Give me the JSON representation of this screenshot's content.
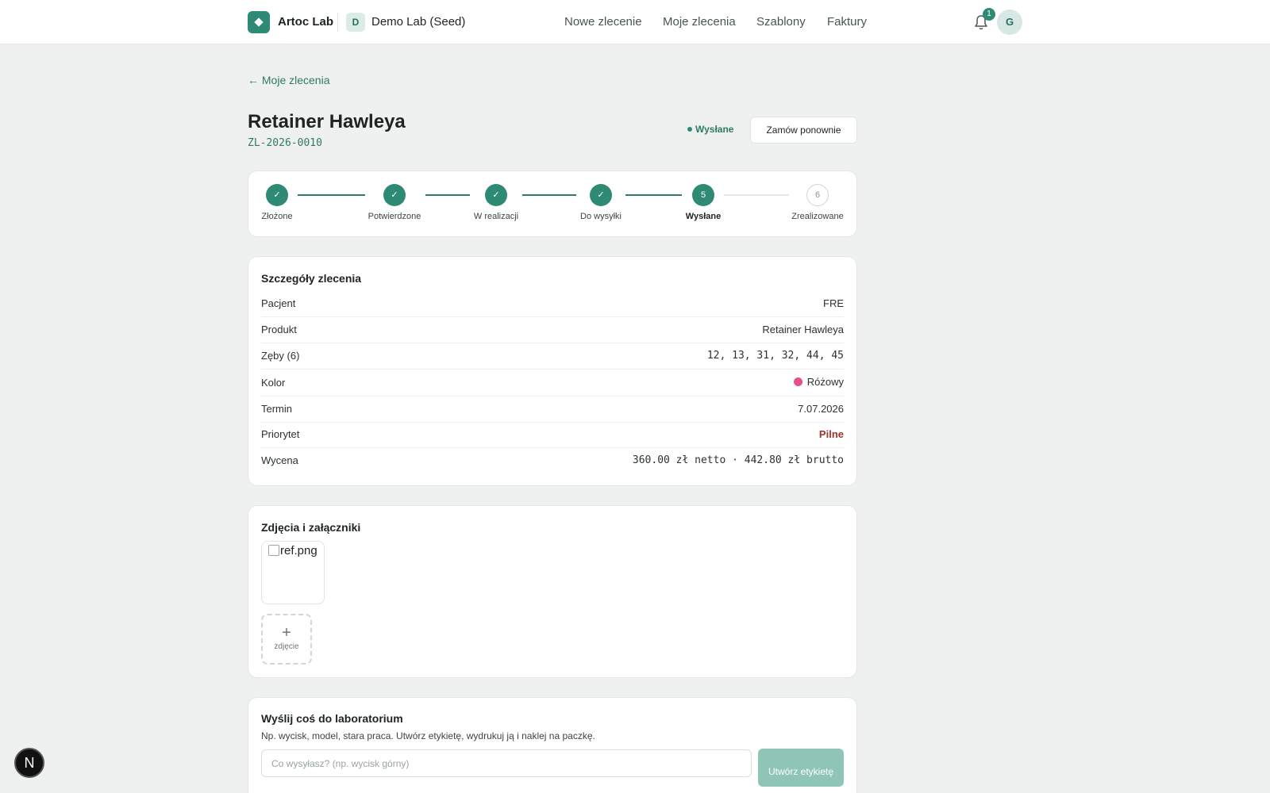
{
  "header": {
    "brand": "Artoc Lab",
    "lab_initial": "D",
    "lab_name": "Demo Lab (Seed)",
    "nav": [
      "Nowe zlecenie",
      "Moje zlecenia",
      "Szablony",
      "Faktury"
    ],
    "notifications_count": "1",
    "avatar_initial": "G",
    "accent_color": "#2e8a74"
  },
  "back_link": "← Moje zlecenia",
  "order": {
    "title": "Retainer Hawleya",
    "code": "ZL-2026-0010",
    "status": "Wysłane",
    "reorder_label": "Zamów ponownie"
  },
  "progress": {
    "steps": [
      {
        "label": "Złożone",
        "state": "done",
        "mark": "✓"
      },
      {
        "label": "Potwierdzone",
        "state": "done",
        "mark": "✓"
      },
      {
        "label": "W realizacji",
        "state": "done",
        "mark": "✓"
      },
      {
        "label": "Do wysyłki",
        "state": "done",
        "mark": "✓"
      },
      {
        "label": "Wysłane",
        "state": "current",
        "mark": "5"
      },
      {
        "label": "Zrealizowane",
        "state": "todo",
        "mark": "6"
      }
    ]
  },
  "details": {
    "title": "Szczegóły zlecenia",
    "rows": [
      {
        "label": "Pacjent",
        "value": "FRE"
      },
      {
        "label": "Produkt",
        "value": "Retainer Hawleya"
      },
      {
        "label": "Zęby (6)",
        "value": "12, 13, 31, 32, 44, 45"
      },
      {
        "label": "Kolor",
        "value": "Różowy",
        "color": "#e54f8d"
      },
      {
        "label": "Termin",
        "value": "7.07.2026"
      },
      {
        "label": "Priorytet",
        "value": "Pilne"
      },
      {
        "label": "Wycena",
        "value": "360.00 zł netto · 442.80 zł brutto"
      }
    ]
  },
  "attachments": {
    "title": "Zdjęcia i załączniki",
    "files": [
      "ref.png"
    ],
    "add_icon": "+",
    "add_label": "zdjęcie"
  },
  "send": {
    "title": "Wyślij coś do laboratorium",
    "description": "Np. wycisk, model, stara praca. Utwórz etykietę, wydrukuj ją i naklej na paczkę.",
    "input_placeholder": "Co wysyłasz? (np. wycisk górny)",
    "button_label": "Utwórz etykietę"
  },
  "dev_badge": "N"
}
